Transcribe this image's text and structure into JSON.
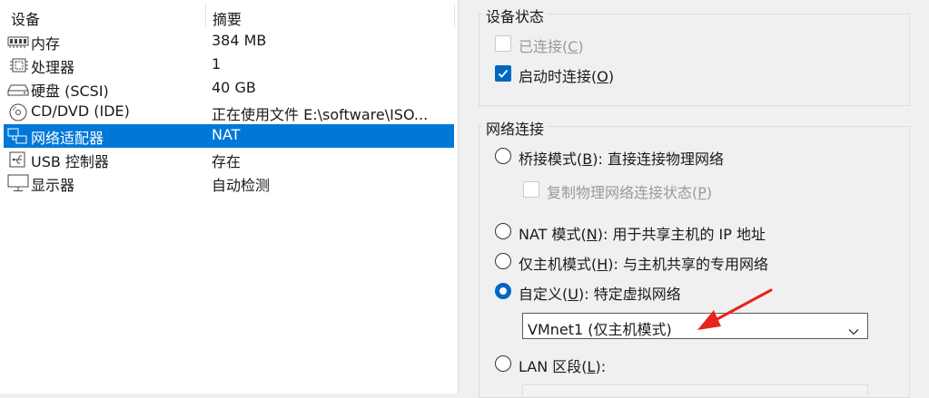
{
  "device_list": {
    "header": {
      "device": "设备",
      "summary": "摘要"
    },
    "rows": [
      {
        "name": "内存",
        "summary": "384 MB",
        "icon": "memory-icon"
      },
      {
        "name": "处理器",
        "summary": "1",
        "icon": "cpu-icon"
      },
      {
        "name": "硬盘 (SCSI)",
        "summary": "40 GB",
        "icon": "hard-disk-icon"
      },
      {
        "name": "CD/DVD (IDE)",
        "summary": "正在使用文件 E:\\software\\ISO...",
        "icon": "cd-dvd-icon"
      },
      {
        "name": "网络适配器",
        "summary": "NAT",
        "icon": "network-adapter-icon",
        "selected": true
      },
      {
        "name": "USB 控制器",
        "summary": "存在",
        "icon": "usb-icon"
      },
      {
        "name": "显示器",
        "summary": "自动检测",
        "icon": "display-icon"
      }
    ]
  },
  "device_status": {
    "title": "设备状态",
    "connected": {
      "label": "已连接(",
      "key": "C",
      "suffix": ")",
      "checked": false,
      "enabled": false
    },
    "connect_at_power_on": {
      "label": "启动时连接(",
      "key": "O",
      "suffix": ")",
      "checked": true,
      "enabled": true
    }
  },
  "network_connection": {
    "title": "网络连接",
    "bridged": {
      "label": "桥接模式(",
      "key": "B",
      "suffix": "): 直接连接物理网络",
      "selected": false
    },
    "replicate_state": {
      "label": "复制物理网络连接状态(",
      "key": "P",
      "suffix": ")",
      "checked": false,
      "enabled": false
    },
    "nat": {
      "label": "NAT 模式(",
      "key": "N",
      "suffix": "): 用于共享主机的 IP 地址",
      "selected": false
    },
    "host_only": {
      "label": "仅主机模式(",
      "key": "H",
      "suffix": "): 与主机共享的专用网络",
      "selected": false
    },
    "custom": {
      "label": "自定义(",
      "key": "U",
      "suffix": "): 特定虚拟网络",
      "selected": true
    },
    "custom_network_value": "VMnet1 (仅主机模式)",
    "lan_segment": {
      "label": "LAN 区段(",
      "key": "L",
      "suffix": "):",
      "selected": false
    }
  },
  "colors": {
    "selection": "#0078d7",
    "accent": "#0067c0",
    "annotation_arrow": "#e8231b"
  }
}
